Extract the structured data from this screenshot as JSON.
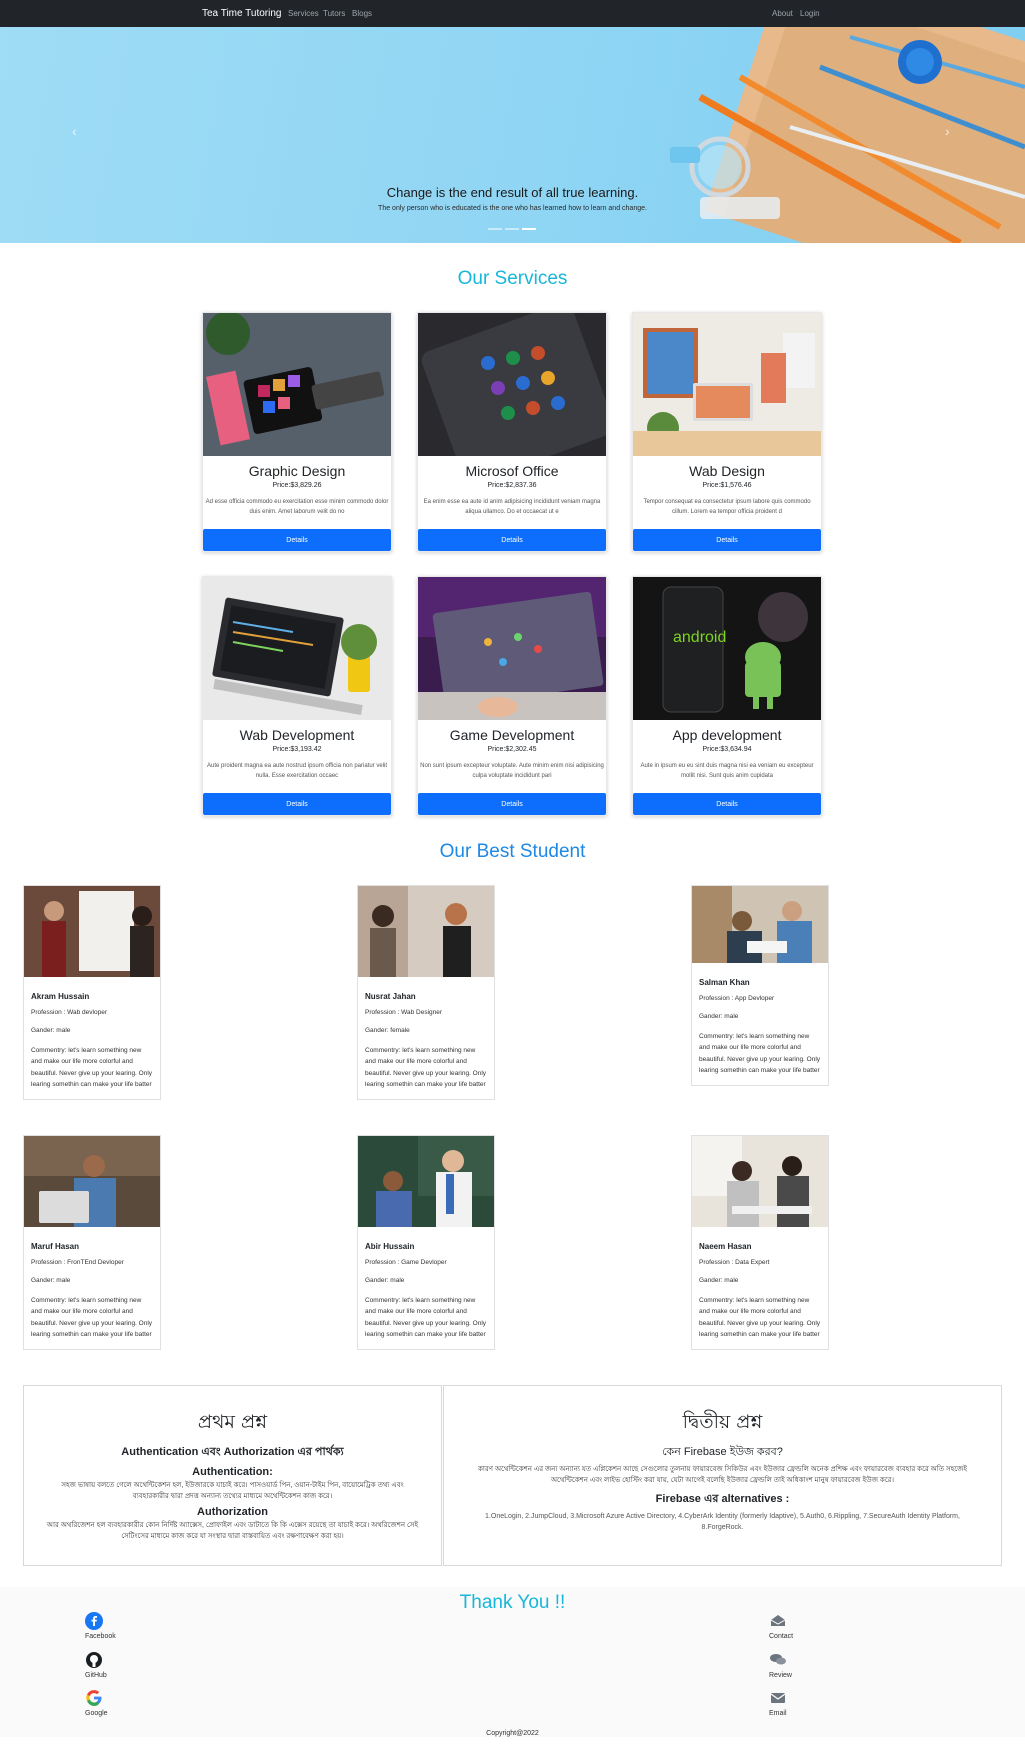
{
  "navbar": {
    "brand": "Tea Time Tutoring",
    "links": [
      "Services",
      "Tutors",
      "Blogs"
    ],
    "right_links": [
      "About",
      "Login"
    ]
  },
  "hero": {
    "title": "Change is the end result of all true learning.",
    "subtitle": "The only person who is educated is the one who has learned how to learn and change.",
    "prev_glyph": "‹",
    "next_glyph": "›"
  },
  "services": {
    "title": "Our Services",
    "title_color": "#17b7d9",
    "button_color": "#0d6efd",
    "items": [
      {
        "name": "Graphic Design",
        "price": "Price:$3,829.26",
        "desc": "Ad esse officia commodo eu exercitation esse minim commodo dolor duis enim. Amet laborum velit do no",
        "button": "Details"
      },
      {
        "name": "Microsof Office",
        "price": "Price:$2,837.36",
        "desc": "Ea enim esse ea aute id anim adipisicing incididunt veniam magna aliqua ullamco. Do et occaecat ut e",
        "button": "Details"
      },
      {
        "name": "Wab Design",
        "price": "Price:$1,576.46",
        "desc": "Tempor consequat ea consectetur ipsum labore quis commodo cillum. Lorem ea tempor officia proident d",
        "button": "Details"
      },
      {
        "name": "Wab Development",
        "price": "Price:$3,193.42",
        "desc": "Aute proident magna ea aute nostrud ipsum officia non pariatur velit nulla. Esse exercitation occaec",
        "button": "Details"
      },
      {
        "name": "Game Development",
        "price": "Price:$2,302.45",
        "desc": "Non sunt ipsum excepteur voluptate. Aute minim enim nisi adipisicing culpa voluptate incididunt pari",
        "button": "Details"
      },
      {
        "name": "App development",
        "price": "Price:$3,634.94",
        "desc": "Aute in ipsum eu eu sint duis magna nisi ea veniam eu excepteur mollit nisi. Sunt quis anim cupidata",
        "button": "Details"
      }
    ]
  },
  "students": {
    "title": "Our Best Student",
    "title_color": "#1e88e5",
    "items": [
      {
        "name": "Akram Hussain",
        "profession": "Profession : Wab devloper",
        "gender": "Gander: male",
        "comment": "Commentry: let's learn something new and make our life more colorful and beautiful. Never give up your learing. Only learing somethin can make your life batter"
      },
      {
        "name": "Nusrat Jahan",
        "profession": "Profession : Wab Designer",
        "gender": "Gander: female",
        "comment": "Commentry: let's learn something new and make our life more colorful and beautiful. Never give up your learing. Only learing somethin can make your life batter"
      },
      {
        "name": "Salman Khan",
        "profession": "Profession : App Devloper",
        "gender": "Gander: male",
        "comment": "Commentry: let's learn something new and make our life more colorful and beautiful. Never give up your learing. Only learing somethin can make your life batter"
      },
      {
        "name": "Maruf Hasan",
        "profession": "Profession : FronTEnd Devloper",
        "gender": "Gander: male",
        "comment": "Commentry: let's learn something new and make our life more colorful and beautiful. Never give up your learing. Only learing somethin can make your life batter"
      },
      {
        "name": "Abir Hussain",
        "profession": "Profession : Game Devloper",
        "gender": "Gander: male",
        "comment": "Commentry: let's learn something new and make our life more colorful and beautiful. Never give up your learing. Only learing somethin can make your life batter"
      },
      {
        "name": "Naeem Hasan",
        "profession": "Profession : Data Expert",
        "gender": "Gander: male",
        "comment": "Commentry: let's learn something new and make our life more colorful and beautiful. Never give up your learing. Only learing somethin can make your life batter"
      }
    ]
  },
  "qa": {
    "left": {
      "heading": "প্রথম প্রশ্ন",
      "question": "Authentication এবং Authorization এর পার্থক্য",
      "sub1": "Authentication:",
      "text1": "সহজ ভাষায় বলতে গেলে অথেন্টিকেশন হল, ইউজারকে যাচাই করে। পাসওয়ার্ড পিন, ওয়ান-টাইম পিন, বায়োমেট্রিক তথ্য এবং ব্যবহারকারীর দ্বারা প্রদত্ত অন্যান্য তথ্যের মাধ্যমে অথেন্টিকেশন কাজ করে।",
      "sub2": "Authorization",
      "text2": "আর অথরিজেশন হল ব্যবহারকারীর কোন নির্দিষ্ট অ্যাক্সেস, প্রোফাইল এবং ডাটাতে কি কি এক্সেস রয়েছে তা যাচাই করে। অথরিজেশন সেই সেটিংসের মাধ্যমে কাজ করে যা সংস্থার দ্বারা বাস্তবায়িত এবং রক্ষণাবেক্ষণ করা হয়।"
    },
    "right": {
      "heading": "দ্বিতীয় প্রশ্ন",
      "question": "কেন Firebase ইউজ করব?",
      "text1": "কারণ অথেন্টিকেশন এর জন্য অন্যান্য যত এপ্লিকেশন আছে সেগুলোর তুলনায় ফায়ারবেজ সিকিউর এবং ইউজার ফ্রেন্ডলি অনেক প্রশিক্ষ এবং ফায়ারবেজ ব্যবহার করে অতি সহজেই অথেন্টিকেশন এবং লাইভ হোস্টিং করা যায়, যেটা আগেই বলেছি ইউজার ফ্রেন্ডলি তাই অধিকাংশ মানুষ ফায়ারবেজ ইউজ করে।",
      "sub2": "Firebase এর alternatives :",
      "text2": "1.OneLogin, 2.JumpCloud, 3.Microsoft Azure Active Directory, 4.CyberArk Identity (formerly Idaptive), 5.Auth0, 6.Rippling, 7.SecureAuth Identity Platform, 8.ForgeRock."
    }
  },
  "footer": {
    "title": "Thank You !!",
    "title_color": "#17b7d9",
    "left_links": [
      {
        "label": "Facebook",
        "icon": "facebook-icon"
      },
      {
        "label": "GitHub",
        "icon": "github-icon"
      },
      {
        "label": "Google",
        "icon": "google-icon"
      }
    ],
    "right_links": [
      {
        "label": "Contact",
        "icon": "contact-icon"
      },
      {
        "label": "Review",
        "icon": "review-icon"
      },
      {
        "label": "Email",
        "icon": "email-icon"
      }
    ],
    "copyright": "Copyright@2022"
  }
}
